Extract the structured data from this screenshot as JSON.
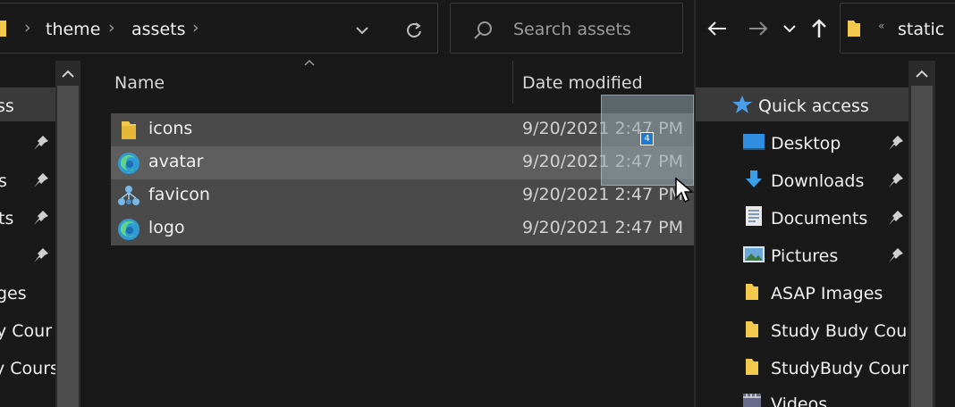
{
  "left_window": {
    "breadcrumb": [
      "theme",
      "assets"
    ],
    "search_placeholder": "Search assets",
    "columns": {
      "name": "Name",
      "date": "Date modified"
    },
    "files": [
      {
        "name": "icons",
        "date": "9/20/2021 2:47 PM",
        "icon": "folder-icon"
      },
      {
        "name": "avatar",
        "date": "9/20/2021 2:47 PM",
        "icon": "edge-icon"
      },
      {
        "name": "favicon",
        "date": "9/20/2021 2:47 PM",
        "icon": "network-icon"
      },
      {
        "name": "logo",
        "date": "9/20/2021 2:47 PM",
        "icon": "edge-icon"
      }
    ],
    "drag_count": "4",
    "nav_fragments": [
      "ss",
      "s",
      "ts",
      "ges",
      "y Cour",
      "y Cours"
    ]
  },
  "right_window": {
    "address": "static",
    "address_chevron": "«",
    "nav": [
      {
        "label": "Quick access",
        "icon": "star-icon",
        "pinned": false
      },
      {
        "label": "Desktop",
        "icon": "desktop-icon",
        "pinned": true
      },
      {
        "label": "Downloads",
        "icon": "download-icon",
        "pinned": true
      },
      {
        "label": "Documents",
        "icon": "documents-icon",
        "pinned": true
      },
      {
        "label": "Pictures",
        "icon": "pictures-icon",
        "pinned": true
      },
      {
        "label": "ASAP Images",
        "icon": "folder-icon",
        "pinned": false
      },
      {
        "label": "Study Budy Cour",
        "icon": "folder-icon",
        "pinned": false
      },
      {
        "label": "StudyBudy Cours",
        "icon": "folder-icon",
        "pinned": false
      },
      {
        "label": "Videos",
        "icon": "videos-icon",
        "pinned": false
      }
    ]
  },
  "colors": {
    "background": "#191919",
    "selection": "#4a4a4a",
    "hover": "#5e5e5e",
    "accent": "#1e78d0",
    "folder": "#f2c94c"
  }
}
